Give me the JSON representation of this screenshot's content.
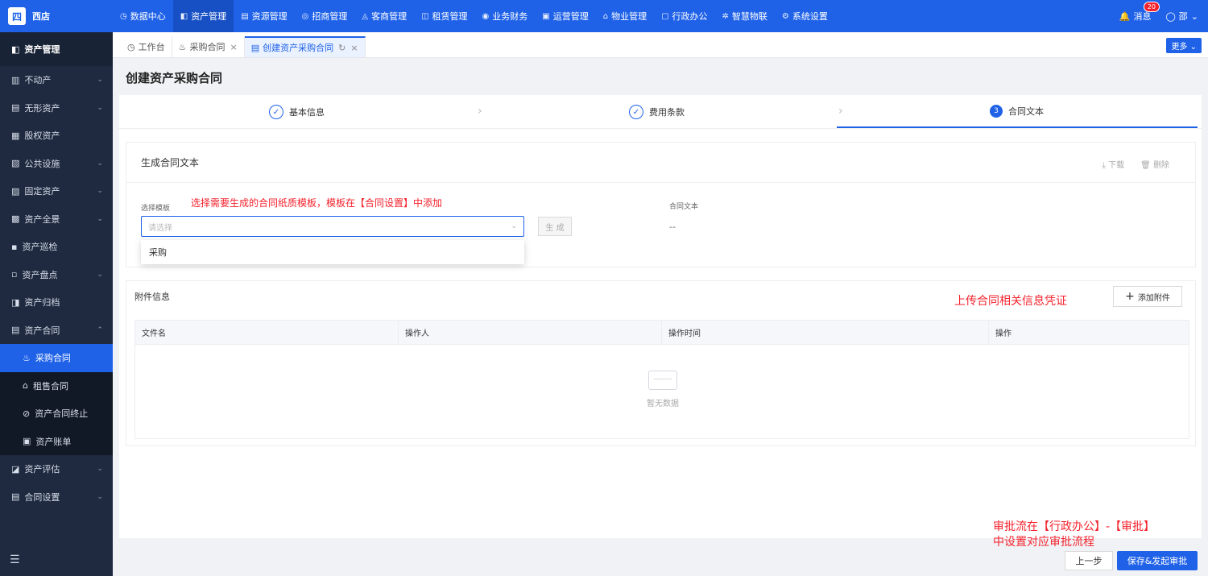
{
  "app": {
    "logo_char": "四",
    "name": "西店"
  },
  "topnav": [
    {
      "icon": "◷",
      "label": "数据中心",
      "active": false
    },
    {
      "icon": "◧",
      "label": "资产管理",
      "active": true
    },
    {
      "icon": "▤",
      "label": "资源管理",
      "active": false
    },
    {
      "icon": "◎",
      "label": "招商管理",
      "active": false
    },
    {
      "icon": "◬",
      "label": "客商管理",
      "active": false
    },
    {
      "icon": "◫",
      "label": "租赁管理",
      "active": false
    },
    {
      "icon": "◉",
      "label": "业务财务",
      "active": false
    },
    {
      "icon": "▣",
      "label": "运营管理",
      "active": false
    },
    {
      "icon": "⌂",
      "label": "物业管理",
      "active": false
    },
    {
      "icon": "▢",
      "label": "行政办公",
      "active": false
    },
    {
      "icon": "✲",
      "label": "智慧物联",
      "active": false
    },
    {
      "icon": "⚙",
      "label": "系统设置",
      "active": false
    }
  ],
  "top_right": {
    "msg_label": "消息",
    "msg_count": "20",
    "user_name": "邵"
  },
  "sidebar": {
    "head": "资产管理",
    "items": [
      {
        "icon": "▥",
        "label": "不动产",
        "chev": "⌄"
      },
      {
        "icon": "▤",
        "label": "无形资产",
        "chev": "⌄"
      },
      {
        "icon": "▦",
        "label": "股权资产",
        "chev": ""
      },
      {
        "icon": "▧",
        "label": "公共设施",
        "chev": "⌄"
      },
      {
        "icon": "▨",
        "label": "固定资产",
        "chev": "⌄"
      },
      {
        "icon": "▩",
        "label": "资产全景",
        "chev": "⌄"
      },
      {
        "icon": "▪",
        "label": "资产巡检",
        "chev": ""
      },
      {
        "icon": "▫",
        "label": "资产盘点",
        "chev": "⌄"
      },
      {
        "icon": "◨",
        "label": "资产归档",
        "chev": ""
      },
      {
        "icon": "▤",
        "label": "资产合同",
        "chev": "⌃"
      }
    ],
    "subitems": [
      {
        "icon": "♨",
        "label": "采购合同",
        "active": true
      },
      {
        "icon": "⌂",
        "label": "租售合同",
        "active": false
      },
      {
        "icon": "⊘",
        "label": "资产合同终止",
        "active": false
      },
      {
        "icon": "▣",
        "label": "资产账单",
        "active": false
      }
    ],
    "after_items": [
      {
        "icon": "◪",
        "label": "资产评估",
        "chev": "⌄"
      },
      {
        "icon": "▤",
        "label": "合同设置",
        "chev": "⌄"
      }
    ],
    "bottom_icon": "☰"
  },
  "tabs": [
    {
      "icon": "◷",
      "label": "工作台",
      "closable": false,
      "active": false
    },
    {
      "icon": "♨",
      "label": "采购合同",
      "closable": true,
      "active": false
    },
    {
      "icon": "▤",
      "label": "创建资产采购合同",
      "closable": true,
      "active": true
    }
  ],
  "tab_refresh_icon": "↻",
  "tab_close_icon": "×",
  "more_label": "更多 ⌄",
  "page_title": "创建资产采购合同",
  "steps": [
    {
      "mark": "✓",
      "label": "基本信息"
    },
    {
      "mark": "✓",
      "label": "费用条款"
    },
    {
      "mark": "3",
      "label": "合同文本"
    }
  ],
  "generate_panel": {
    "title": "生成合同文本",
    "download": "⤓ 下载",
    "delete": "🗑 删除",
    "template_label": "选择模板",
    "note": "选择需要生成的合同纸质模板，模板在【合同设置】中添加",
    "placeholder": "请选择",
    "generate_btn": "生 成",
    "text_label": "合同文本",
    "text_value": "--",
    "dropdown_option": "采购"
  },
  "attach_panel": {
    "title": "附件信息",
    "note": "上传合同相关信息凭证",
    "add_btn": "添加附件",
    "columns": [
      "文件名",
      "操作人",
      "操作时间",
      "操作"
    ],
    "empty_text": "暂无数据"
  },
  "bottom_note": [
    "审批流在【行政办公】-【审批】",
    "中设置对应审批流程"
  ],
  "buttons": {
    "prev": "上一步",
    "submit": "保存&发起审批"
  }
}
